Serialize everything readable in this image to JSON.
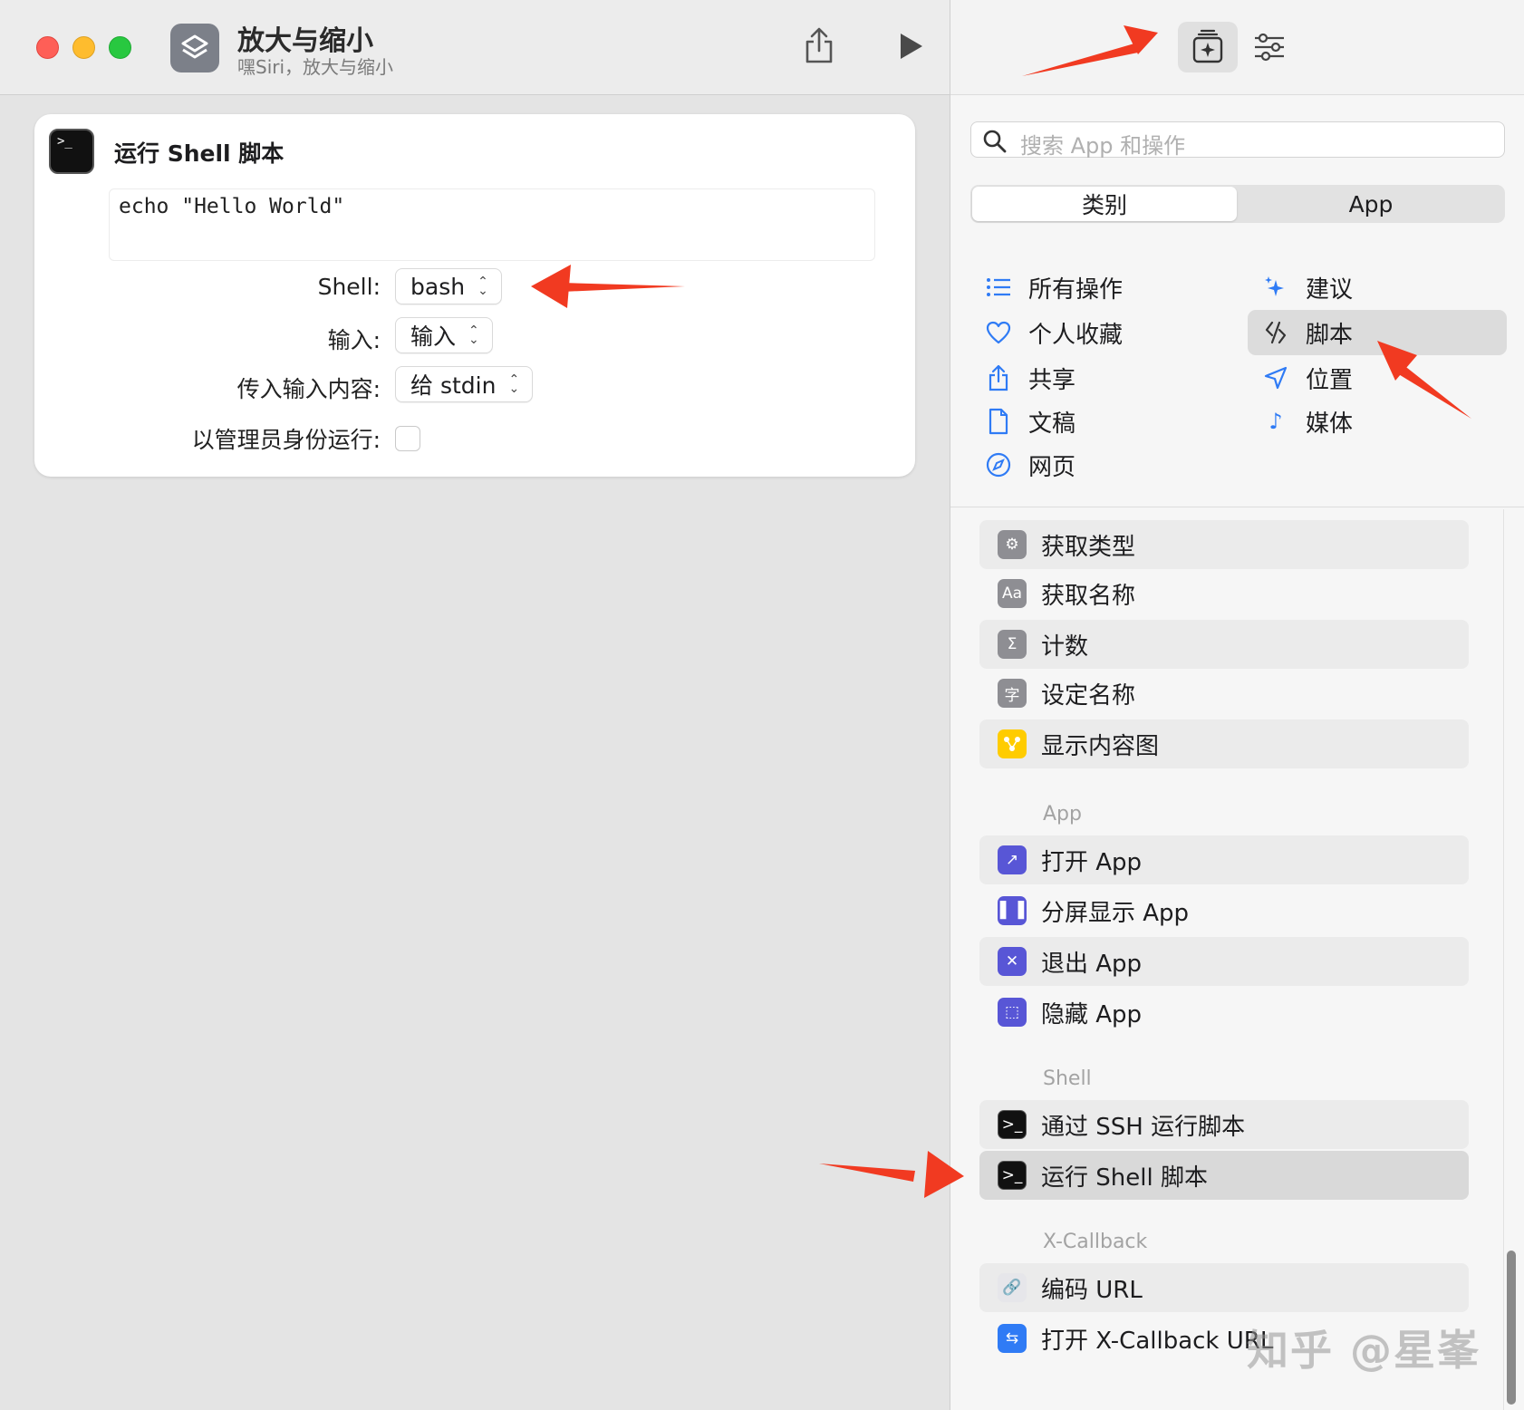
{
  "window": {
    "title": "放大与缩小",
    "subtitle": "嘿Siri，放大与缩小"
  },
  "action_card": {
    "title": "运行 Shell 脚本",
    "script": "echo \"Hello World\"",
    "rows": [
      {
        "label": "Shell:",
        "value": "bash"
      },
      {
        "label": "输入:",
        "value": "输入"
      },
      {
        "label": "传入输入内容:",
        "value": "给 stdin"
      },
      {
        "label": "以管理员身份运行:"
      }
    ],
    "run_as_admin": false
  },
  "library": {
    "search_placeholder": "搜索 App 和操作",
    "segments": [
      "类别",
      "App"
    ],
    "selected_segment": "类别",
    "categories_left": [
      {
        "label": "所有操作",
        "icon": "list-icon"
      },
      {
        "label": "个人收藏",
        "icon": "heart-icon"
      },
      {
        "label": "共享",
        "icon": "share-icon"
      },
      {
        "label": "文稿",
        "icon": "document-icon"
      },
      {
        "label": "网页",
        "icon": "compass-icon"
      }
    ],
    "categories_right": [
      {
        "label": "建议",
        "icon": "sparkles-icon"
      },
      {
        "label": "脚本",
        "icon": "script-icon",
        "selected": true
      },
      {
        "label": "位置",
        "icon": "location-icon"
      },
      {
        "label": "媒体",
        "icon": "music-note-icon"
      }
    ],
    "group1_items": [
      "获取类型",
      "获取名称",
      "计数",
      "设定名称",
      "显示内容图"
    ],
    "app_section": "App",
    "app_items": [
      "打开 App",
      "分屏显示 App",
      "退出 App",
      "隐藏 App"
    ],
    "shell_section": "Shell",
    "shell_items": [
      "通过 SSH 运行脚本",
      "运行 Shell 脚本"
    ],
    "xcallback_section": "X-Callback",
    "xcallback_items": [
      "编码 URL",
      "打开 X-Callback URL"
    ]
  },
  "watermark": "知乎 @星峯",
  "colors": {
    "annotation_arrow": "#f13a21",
    "accent": "#2f7bf5"
  }
}
